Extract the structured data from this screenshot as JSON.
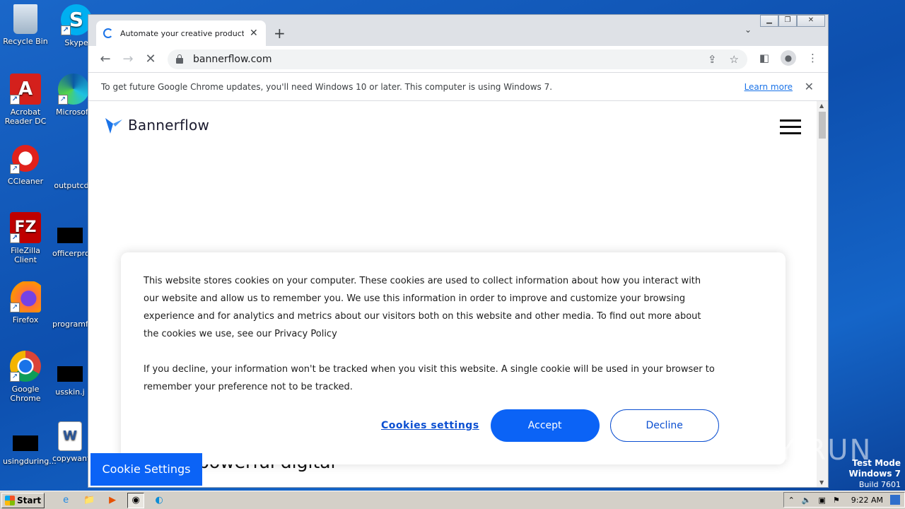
{
  "desktop": {
    "icons_left": [
      {
        "label": "Recycle Bin",
        "glyph": "🗑"
      },
      {
        "label": "Acrobat Reader DC",
        "glyph": "A"
      },
      {
        "label": "CCleaner",
        "glyph": "C"
      },
      {
        "label": "FileZilla Client",
        "glyph": "FZ"
      },
      {
        "label": "Firefox",
        "glyph": "🦊"
      },
      {
        "label": "Google Chrome",
        "glyph": "◉"
      },
      {
        "label": "usingduring..."
      }
    ],
    "icons_right": [
      {
        "label": "Skype",
        "glyph": "S"
      },
      {
        "label": "Microsoft",
        "glyph": "e"
      },
      {
        "label": "outputcd"
      },
      {
        "label": "officerpro"
      },
      {
        "label": "programf"
      },
      {
        "label": "usskin.j"
      },
      {
        "label": "copywant",
        "glyph": "W"
      }
    ]
  },
  "browser": {
    "tab_title": "Automate your creative production c",
    "url": "bannerflow.com",
    "infobar_text": "To get future Google Chrome updates, you'll need Windows 10 or later. This computer is using Windows 7.",
    "infobar_link": "Learn more"
  },
  "page": {
    "brand": "Bannerflow",
    "hero_text": "powerful digital",
    "cookie_settings_tab": "Cookie Settings",
    "consent": {
      "paragraph1": "This website stores cookies on your computer. These cookies are used to collect information about how you interact with our website and allow us to remember you. We use this information in order to improve and customize your browsing experience and for analytics and metrics about our visitors both on this website and other media. To find out more about the cookies we use, see our Privacy Policy",
      "paragraph2": "If you decline, your information won't be tracked when you visit this website. A single cookie will be used in your browser to remember your preference not to be tracked.",
      "settings_label": "Cookies settings",
      "accept_label": "Accept",
      "decline_label": "Decline"
    }
  },
  "watermark": "ANY RUN",
  "testmode": {
    "line1": "Test Mode",
    "line2": "Windows 7",
    "line3": "Build 7601"
  },
  "taskbar": {
    "start_label": "Start",
    "clock": "9:22 AM"
  },
  "colors": {
    "accent": "#0b63f6",
    "brand_blue": "#1a73e8"
  }
}
